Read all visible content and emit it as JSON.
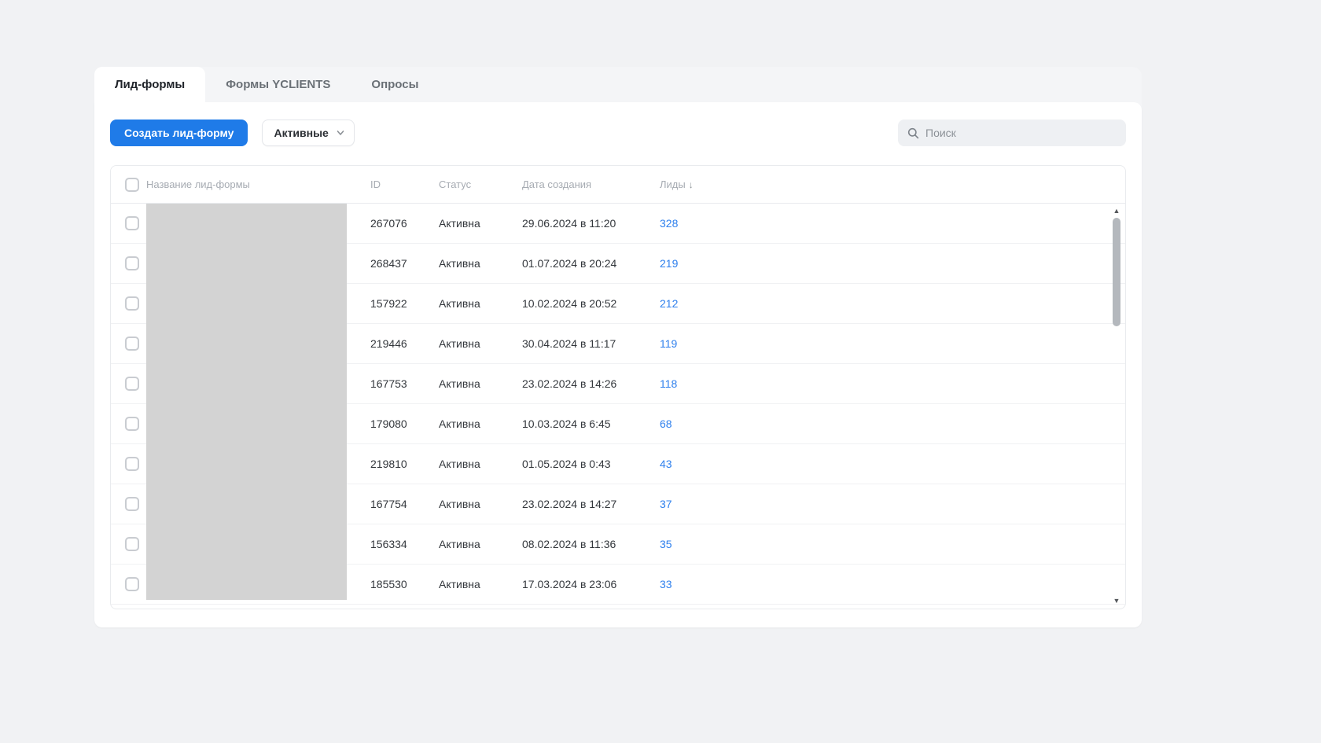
{
  "tabs": [
    {
      "label": "Лид-формы",
      "active": true
    },
    {
      "label": "Формы YCLIENTS",
      "active": false
    },
    {
      "label": "Опросы",
      "active": false
    }
  ],
  "toolbar": {
    "create_button": "Создать лид-форму",
    "filter_value": "Активные",
    "search_placeholder": "Поиск"
  },
  "table": {
    "columns": [
      "Название лид-формы",
      "ID",
      "Статус",
      "Дата создания",
      "Лиды"
    ],
    "sort_arrow": "↓",
    "rows": [
      {
        "id": "267076",
        "status": "Активна",
        "created": "29.06.2024 в 11:20",
        "leads": "328"
      },
      {
        "id": "268437",
        "status": "Активна",
        "created": "01.07.2024 в 20:24",
        "leads": "219"
      },
      {
        "id": "157922",
        "status": "Активна",
        "created": "10.02.2024 в 20:52",
        "leads": "212"
      },
      {
        "id": "219446",
        "status": "Активна",
        "created": "30.04.2024 в 11:17",
        "leads": "119"
      },
      {
        "id": "167753",
        "status": "Активна",
        "created": "23.02.2024 в 14:26",
        "leads": "118"
      },
      {
        "id": "179080",
        "status": "Активна",
        "created": "10.03.2024 в 6:45",
        "leads": "68"
      },
      {
        "id": "219810",
        "status": "Активна",
        "created": "01.05.2024 в 0:43",
        "leads": "43"
      },
      {
        "id": "167754",
        "status": "Активна",
        "created": "23.02.2024 в 14:27",
        "leads": "37"
      },
      {
        "id": "156334",
        "status": "Активна",
        "created": "08.02.2024 в 11:36",
        "leads": "35"
      },
      {
        "id": "185530",
        "status": "Активна",
        "created": "17.03.2024 в 23:06",
        "leads": "33"
      }
    ]
  }
}
